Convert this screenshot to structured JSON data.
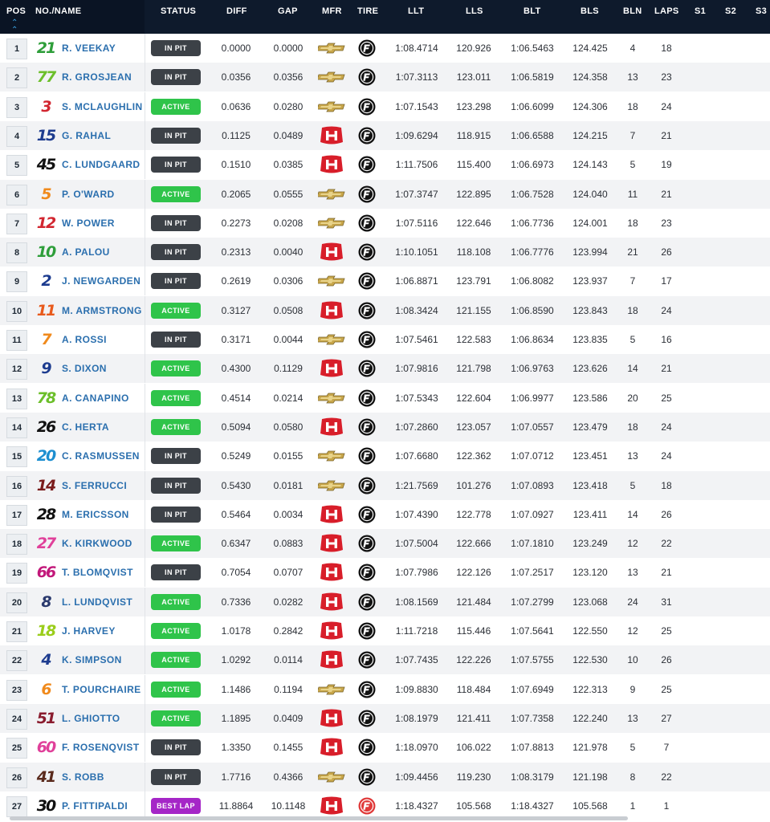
{
  "header": {
    "pos": "POS",
    "no_name": "NO./NAME",
    "status": "STATUS",
    "diff": "DIFF",
    "gap": "GAP",
    "mfr": "MFR",
    "tire": "TIRE",
    "llt": "LLT",
    "lls": "LLS",
    "blt": "BLT",
    "bls": "BLS",
    "bln": "BLN",
    "laps": "LAPS",
    "s1": "S1",
    "s2": "S2",
    "s3": "S3"
  },
  "status_labels": {
    "pit": "IN PIT",
    "active": "ACTIVE",
    "best": "BEST LAP"
  },
  "colors": {
    "header_bg": "#0e1a2c",
    "status_pit": "#3c4147",
    "status_active": "#2fc44a",
    "status_best": "#a526c7",
    "driver_name": "#2b6fae",
    "tire_black": "#111111",
    "tire_red": "#e03a3a"
  },
  "icons": {
    "chevrolet": "chevrolet-bowtie-icon",
    "honda": "honda-h-icon",
    "firestone": "firestone-f-icon",
    "sort": "sort-ascending-icon"
  },
  "rows": [
    {
      "pos": "1",
      "num": "21",
      "numColor": "#2e9e3a",
      "name": "R. VEEKAY",
      "status": "pit",
      "diff": "0.0000",
      "gap": "0.0000",
      "mfr": "chevrolet",
      "tire": "black",
      "llt": "1:08.4714",
      "lls": "120.926",
      "blt": "1:06.5463",
      "bls": "124.425",
      "bln": "4",
      "laps": "18"
    },
    {
      "pos": "2",
      "num": "77",
      "numColor": "#6cbf2a",
      "name": "R. GROSJEAN",
      "status": "pit",
      "diff": "0.0356",
      "gap": "0.0356",
      "mfr": "chevrolet",
      "tire": "black",
      "llt": "1:07.3113",
      "lls": "123.011",
      "blt": "1:06.5819",
      "bls": "124.358",
      "bln": "13",
      "laps": "23"
    },
    {
      "pos": "3",
      "num": "3",
      "numColor": "#d22630",
      "name": "S. MCLAUGHLIN",
      "status": "active",
      "diff": "0.0636",
      "gap": "0.0280",
      "mfr": "chevrolet",
      "tire": "black",
      "llt": "1:07.1543",
      "lls": "123.298",
      "blt": "1:06.6099",
      "bls": "124.306",
      "bln": "18",
      "laps": "24"
    },
    {
      "pos": "4",
      "num": "15",
      "numColor": "#1d3c8f",
      "name": "G. RAHAL",
      "status": "pit",
      "diff": "0.1125",
      "gap": "0.0489",
      "mfr": "honda",
      "tire": "black",
      "llt": "1:09.6294",
      "lls": "118.915",
      "blt": "1:06.6588",
      "bls": "124.215",
      "bln": "7",
      "laps": "21"
    },
    {
      "pos": "5",
      "num": "45",
      "numColor": "#111111",
      "name": "C. LUNDGAARD",
      "status": "pit",
      "diff": "0.1510",
      "gap": "0.0385",
      "mfr": "honda",
      "tire": "black",
      "llt": "1:11.7506",
      "lls": "115.400",
      "blt": "1:06.6973",
      "bls": "124.143",
      "bln": "5",
      "laps": "19"
    },
    {
      "pos": "6",
      "num": "5",
      "numColor": "#f08a1c",
      "name": "P. O'WARD",
      "status": "active",
      "diff": "0.2065",
      "gap": "0.0555",
      "mfr": "chevrolet",
      "tire": "black",
      "llt": "1:07.3747",
      "lls": "122.895",
      "blt": "1:06.7528",
      "bls": "124.040",
      "bln": "11",
      "laps": "21"
    },
    {
      "pos": "7",
      "num": "12",
      "numColor": "#d22630",
      "name": "W. POWER",
      "status": "pit",
      "diff": "0.2273",
      "gap": "0.0208",
      "mfr": "chevrolet",
      "tire": "black",
      "llt": "1:07.5116",
      "lls": "122.646",
      "blt": "1:06.7736",
      "bls": "124.001",
      "bln": "18",
      "laps": "23"
    },
    {
      "pos": "8",
      "num": "10",
      "numColor": "#2e9e3a",
      "name": "A. PALOU",
      "status": "pit",
      "diff": "0.2313",
      "gap": "0.0040",
      "mfr": "honda",
      "tire": "black",
      "llt": "1:10.1051",
      "lls": "118.108",
      "blt": "1:06.7776",
      "bls": "123.994",
      "bln": "21",
      "laps": "26"
    },
    {
      "pos": "9",
      "num": "2",
      "numColor": "#1d3c8f",
      "name": "J. NEWGARDEN",
      "status": "pit",
      "diff": "0.2619",
      "gap": "0.0306",
      "mfr": "chevrolet",
      "tire": "black",
      "llt": "1:06.8871",
      "lls": "123.791",
      "blt": "1:06.8082",
      "bls": "123.937",
      "bln": "7",
      "laps": "17"
    },
    {
      "pos": "10",
      "num": "11",
      "numColor": "#e85a1c",
      "name": "M. ARMSTRONG",
      "status": "active",
      "diff": "0.3127",
      "gap": "0.0508",
      "mfr": "honda",
      "tire": "black",
      "llt": "1:08.3424",
      "lls": "121.155",
      "blt": "1:06.8590",
      "bls": "123.843",
      "bln": "18",
      "laps": "24"
    },
    {
      "pos": "11",
      "num": "7",
      "numColor": "#f08a1c",
      "name": "A. ROSSI",
      "status": "pit",
      "diff": "0.3171",
      "gap": "0.0044",
      "mfr": "chevrolet",
      "tire": "black",
      "llt": "1:07.5461",
      "lls": "122.583",
      "blt": "1:06.8634",
      "bls": "123.835",
      "bln": "5",
      "laps": "16"
    },
    {
      "pos": "12",
      "num": "9",
      "numColor": "#1d3c8f",
      "name": "S. DIXON",
      "status": "active",
      "diff": "0.4300",
      "gap": "0.1129",
      "mfr": "honda",
      "tire": "black",
      "llt": "1:07.9816",
      "lls": "121.798",
      "blt": "1:06.9763",
      "bls": "123.626",
      "bln": "14",
      "laps": "21"
    },
    {
      "pos": "13",
      "num": "78",
      "numColor": "#6cbf2a",
      "name": "A. CANAPINO",
      "status": "active",
      "diff": "0.4514",
      "gap": "0.0214",
      "mfr": "chevrolet",
      "tire": "black",
      "llt": "1:07.5343",
      "lls": "122.604",
      "blt": "1:06.9977",
      "bls": "123.586",
      "bln": "20",
      "laps": "25"
    },
    {
      "pos": "14",
      "num": "26",
      "numColor": "#111111",
      "name": "C. HERTA",
      "status": "active",
      "diff": "0.5094",
      "gap": "0.0580",
      "mfr": "honda",
      "tire": "black",
      "llt": "1:07.2860",
      "lls": "123.057",
      "blt": "1:07.0557",
      "bls": "123.479",
      "bln": "18",
      "laps": "24"
    },
    {
      "pos": "15",
      "num": "20",
      "numColor": "#1e8fd0",
      "name": "C. RASMUSSEN",
      "status": "pit",
      "diff": "0.5249",
      "gap": "0.0155",
      "mfr": "chevrolet",
      "tire": "black",
      "llt": "1:07.6680",
      "lls": "122.362",
      "blt": "1:07.0712",
      "bls": "123.451",
      "bln": "13",
      "laps": "24"
    },
    {
      "pos": "16",
      "num": "14",
      "numColor": "#7a1c1c",
      "name": "S. FERRUCCI",
      "status": "pit",
      "diff": "0.5430",
      "gap": "0.0181",
      "mfr": "chevrolet",
      "tire": "black",
      "llt": "1:21.7569",
      "lls": "101.276",
      "blt": "1:07.0893",
      "bls": "123.418",
      "bln": "5",
      "laps": "18"
    },
    {
      "pos": "17",
      "num": "28",
      "numColor": "#111111",
      "name": "M. ERICSSON",
      "status": "pit",
      "diff": "0.5464",
      "gap": "0.0034",
      "mfr": "honda",
      "tire": "black",
      "llt": "1:07.4390",
      "lls": "122.778",
      "blt": "1:07.0927",
      "bls": "123.411",
      "bln": "14",
      "laps": "26"
    },
    {
      "pos": "18",
      "num": "27",
      "numColor": "#e0409a",
      "name": "K. KIRKWOOD",
      "status": "active",
      "diff": "0.6347",
      "gap": "0.0883",
      "mfr": "honda",
      "tire": "black",
      "llt": "1:07.5004",
      "lls": "122.666",
      "blt": "1:07.1810",
      "bls": "123.249",
      "bln": "12",
      "laps": "22"
    },
    {
      "pos": "19",
      "num": "66",
      "numColor": "#c2187a",
      "name": "T. BLOMQVIST",
      "status": "pit",
      "diff": "0.7054",
      "gap": "0.0707",
      "mfr": "honda",
      "tire": "black",
      "llt": "1:07.7986",
      "lls": "122.126",
      "blt": "1:07.2517",
      "bls": "123.120",
      "bln": "13",
      "laps": "21"
    },
    {
      "pos": "20",
      "num": "8",
      "numColor": "#2b3a6e",
      "name": "L. LUNDQVIST",
      "status": "active",
      "diff": "0.7336",
      "gap": "0.0282",
      "mfr": "honda",
      "tire": "black",
      "llt": "1:08.1569",
      "lls": "121.484",
      "blt": "1:07.2799",
      "bls": "123.068",
      "bln": "24",
      "laps": "31"
    },
    {
      "pos": "21",
      "num": "18",
      "numColor": "#9acd1a",
      "name": "J. HARVEY",
      "status": "active",
      "diff": "1.0178",
      "gap": "0.2842",
      "mfr": "honda",
      "tire": "black",
      "llt": "1:11.7218",
      "lls": "115.446",
      "blt": "1:07.5641",
      "bls": "122.550",
      "bln": "12",
      "laps": "25"
    },
    {
      "pos": "22",
      "num": "4",
      "numColor": "#1d3c8f",
      "name": "K. SIMPSON",
      "status": "active",
      "diff": "1.0292",
      "gap": "0.0114",
      "mfr": "honda",
      "tire": "black",
      "llt": "1:07.7435",
      "lls": "122.226",
      "blt": "1:07.5755",
      "bls": "122.530",
      "bln": "10",
      "laps": "26"
    },
    {
      "pos": "23",
      "num": "6",
      "numColor": "#f08a1c",
      "name": "T. POURCHAIRE",
      "status": "active",
      "diff": "1.1486",
      "gap": "0.1194",
      "mfr": "chevrolet",
      "tire": "black",
      "llt": "1:09.8830",
      "lls": "118.484",
      "blt": "1:07.6949",
      "bls": "122.313",
      "bln": "9",
      "laps": "25"
    },
    {
      "pos": "24",
      "num": "51",
      "numColor": "#8a1c2e",
      "name": "L. GHIOTTO",
      "status": "active",
      "diff": "1.1895",
      "gap": "0.0409",
      "mfr": "honda",
      "tire": "black",
      "llt": "1:08.1979",
      "lls": "121.411",
      "blt": "1:07.7358",
      "bls": "122.240",
      "bln": "13",
      "laps": "27"
    },
    {
      "pos": "25",
      "num": "60",
      "numColor": "#e0409a",
      "name": "F. ROSENQVIST",
      "status": "pit",
      "diff": "1.3350",
      "gap": "0.1455",
      "mfr": "honda",
      "tire": "black",
      "llt": "1:18.0970",
      "lls": "106.022",
      "blt": "1:07.8813",
      "bls": "121.978",
      "bln": "5",
      "laps": "7"
    },
    {
      "pos": "26",
      "num": "41",
      "numColor": "#5a2a1c",
      "name": "S. ROBB",
      "status": "pit",
      "diff": "1.7716",
      "gap": "0.4366",
      "mfr": "chevrolet",
      "tire": "black",
      "llt": "1:09.4456",
      "lls": "119.230",
      "blt": "1:08.3179",
      "bls": "121.198",
      "bln": "8",
      "laps": "22"
    },
    {
      "pos": "27",
      "num": "30",
      "numColor": "#111111",
      "name": "P. FITTIPALDI",
      "status": "best",
      "diff": "11.8864",
      "gap": "10.1148",
      "mfr": "honda",
      "tire": "red",
      "llt": "1:18.4327",
      "lls": "105.568",
      "blt": "1:18.4327",
      "bls": "105.568",
      "bln": "1",
      "laps": "1"
    }
  ]
}
